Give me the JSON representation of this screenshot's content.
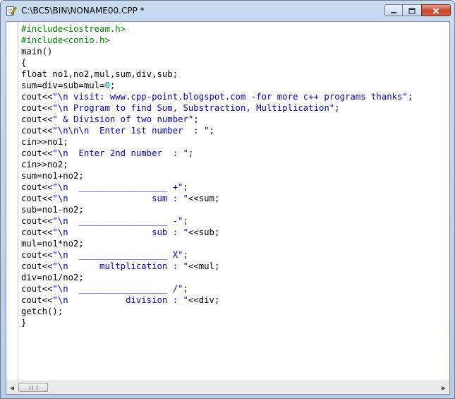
{
  "window": {
    "title": "C:\\BC5\\BIN\\NONAME00.CPP *",
    "icons": [
      "document-edit-icon",
      "minimize-icon",
      "maximize-icon",
      "close-icon"
    ]
  },
  "colors": {
    "directive": "#008000",
    "string": "#0000c0",
    "number": "#008080",
    "plain": "#000000"
  },
  "code": {
    "lines": [
      [
        {
          "t": "dir",
          "v": "#include<iostream.h>"
        }
      ],
      [
        {
          "t": "dir",
          "v": "#include<conio.h>"
        }
      ],
      [
        {
          "t": "plain",
          "v": "main()"
        }
      ],
      [
        {
          "t": "plain",
          "v": "{"
        }
      ],
      [
        {
          "t": "plain",
          "v": "float no1,no2,mul,sum,div,sub;"
        }
      ],
      [
        {
          "t": "plain",
          "v": "sum=div=sub=mul="
        },
        {
          "t": "num",
          "v": "0"
        },
        {
          "t": "plain",
          "v": ";"
        }
      ],
      [
        {
          "t": "plain",
          "v": "cout<<"
        },
        {
          "t": "str",
          "v": "\"\\n visit: www.cpp-point.blogspot.com -for more c++ programs thanks\""
        },
        {
          "t": "plain",
          "v": ";"
        }
      ],
      [
        {
          "t": "plain",
          "v": "cout<<"
        },
        {
          "t": "str",
          "v": "\"\\n Program to find Sum, Substraction, Multiplication\""
        },
        {
          "t": "plain",
          "v": ";"
        }
      ],
      [
        {
          "t": "plain",
          "v": "cout<<"
        },
        {
          "t": "str",
          "v": "\" & Division of two number\""
        },
        {
          "t": "plain",
          "v": ";"
        }
      ],
      [
        {
          "t": "plain",
          "v": "cout<<"
        },
        {
          "t": "str",
          "v": "\"\\n\\n\\n  Enter 1st number  : \""
        },
        {
          "t": "plain",
          "v": ";"
        }
      ],
      [
        {
          "t": "plain",
          "v": "cin>>no1;"
        }
      ],
      [
        {
          "t": "plain",
          "v": "cout<<"
        },
        {
          "t": "str",
          "v": "\"\\n  Enter 2nd number  : \""
        },
        {
          "t": "plain",
          "v": ";"
        }
      ],
      [
        {
          "t": "plain",
          "v": "cin>>no2;"
        }
      ],
      [
        {
          "t": "plain",
          "v": "sum=no1+no2;"
        }
      ],
      [
        {
          "t": "plain",
          "v": "cout<<"
        },
        {
          "t": "str",
          "v": "\"\\n  _________________ +\""
        },
        {
          "t": "plain",
          "v": ";"
        }
      ],
      [
        {
          "t": "plain",
          "v": "cout<<"
        },
        {
          "t": "str",
          "v": "\"\\n                sum : \""
        },
        {
          "t": "plain",
          "v": "<<sum;"
        }
      ],
      [
        {
          "t": "plain",
          "v": "sub=no1-no2;"
        }
      ],
      [
        {
          "t": "plain",
          "v": "cout<<"
        },
        {
          "t": "str",
          "v": "\"\\n  _________________ -\""
        },
        {
          "t": "plain",
          "v": ";"
        }
      ],
      [
        {
          "t": "plain",
          "v": "cout<<"
        },
        {
          "t": "str",
          "v": "\"\\n                sub : \""
        },
        {
          "t": "plain",
          "v": "<<sub;"
        }
      ],
      [
        {
          "t": "plain",
          "v": "mul=no1*no2;"
        }
      ],
      [
        {
          "t": "plain",
          "v": "cout<<"
        },
        {
          "t": "str",
          "v": "\"\\n  _________________ X\""
        },
        {
          "t": "plain",
          "v": ";"
        }
      ],
      [
        {
          "t": "plain",
          "v": "cout<<"
        },
        {
          "t": "str",
          "v": "\"\\n      multplication : \""
        },
        {
          "t": "plain",
          "v": "<<mul;"
        }
      ],
      [
        {
          "t": "plain",
          "v": "div=no1/no2;"
        }
      ],
      [
        {
          "t": "plain",
          "v": "cout<<"
        },
        {
          "t": "str",
          "v": "\"\\n  _________________ /\""
        },
        {
          "t": "plain",
          "v": ";"
        }
      ],
      [
        {
          "t": "plain",
          "v": "cout<<"
        },
        {
          "t": "str",
          "v": "\"\\n           division : \""
        },
        {
          "t": "plain",
          "v": "<<div;"
        }
      ],
      [
        {
          "t": "plain",
          "v": "getch();"
        }
      ],
      [
        {
          "t": "plain",
          "v": "}"
        }
      ]
    ]
  },
  "scrollbar": {
    "left_arrow": "◀",
    "right_arrow": "▶"
  }
}
